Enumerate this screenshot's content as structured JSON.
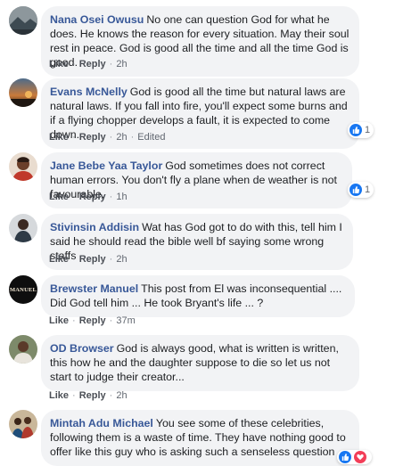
{
  "actions": {
    "like": "Like",
    "reply": "Reply",
    "edited": "Edited",
    "sep": "·"
  },
  "comments": [
    {
      "author": "Nana Osei Owusu",
      "text": "No one can question God for what he does. He knows the reason for every situation. May their soul rest in peace. God is good all the time and all the time God is good.",
      "time": "2h",
      "avatar_icon": "landscape-avatar"
    },
    {
      "author": "Evans McNelly",
      "text": "God is good all the time but natural laws are natural laws. If you fall into fire, you'll expect some burns and if a flying chopper develops a fault, it is expected to come down.",
      "time": "2h",
      "reactions": "1",
      "avatar_icon": "sunset-avatar"
    },
    {
      "author": "Jane Bebe Yaa Taylor",
      "text": "God sometimes does not correct human errors. You don't fly a plane when de weather is not favourable.",
      "time": "1h",
      "reactions": "1",
      "avatar_icon": "person-avatar"
    },
    {
      "author": "Stivinsin Addisin",
      "text": "Wat has God got to do with this, tell him I said he should read the bible well bf saying some wrong staffs",
      "time": "2h",
      "avatar_icon": "person-avatar"
    },
    {
      "author": "Brewster Manuel",
      "text": "This post from El was inconsequential .... Did God tell him ... He took Bryant's life ... ?",
      "time": "37m",
      "avatar_icon": "manuel-logo-avatar",
      "avatar_text": "MANUEL"
    },
    {
      "author": "OD Browser",
      "text": "God is always good, what is written is written, this how he and the daughter suppose to die so let us not start to judge their creator...",
      "time": "2h",
      "avatar_icon": "person-avatar"
    },
    {
      "author": "Mintah Adu Michael",
      "text": "You see some of these celebrities, following them is a waste of time. They have nothing good to offer like this guy who is asking such a senseless question",
      "avatar_icon": "group-avatar"
    }
  ],
  "colors": {
    "author": "#385898",
    "bubble": "#f2f3f5",
    "like": "#1877f2",
    "love": "#f33e58"
  }
}
